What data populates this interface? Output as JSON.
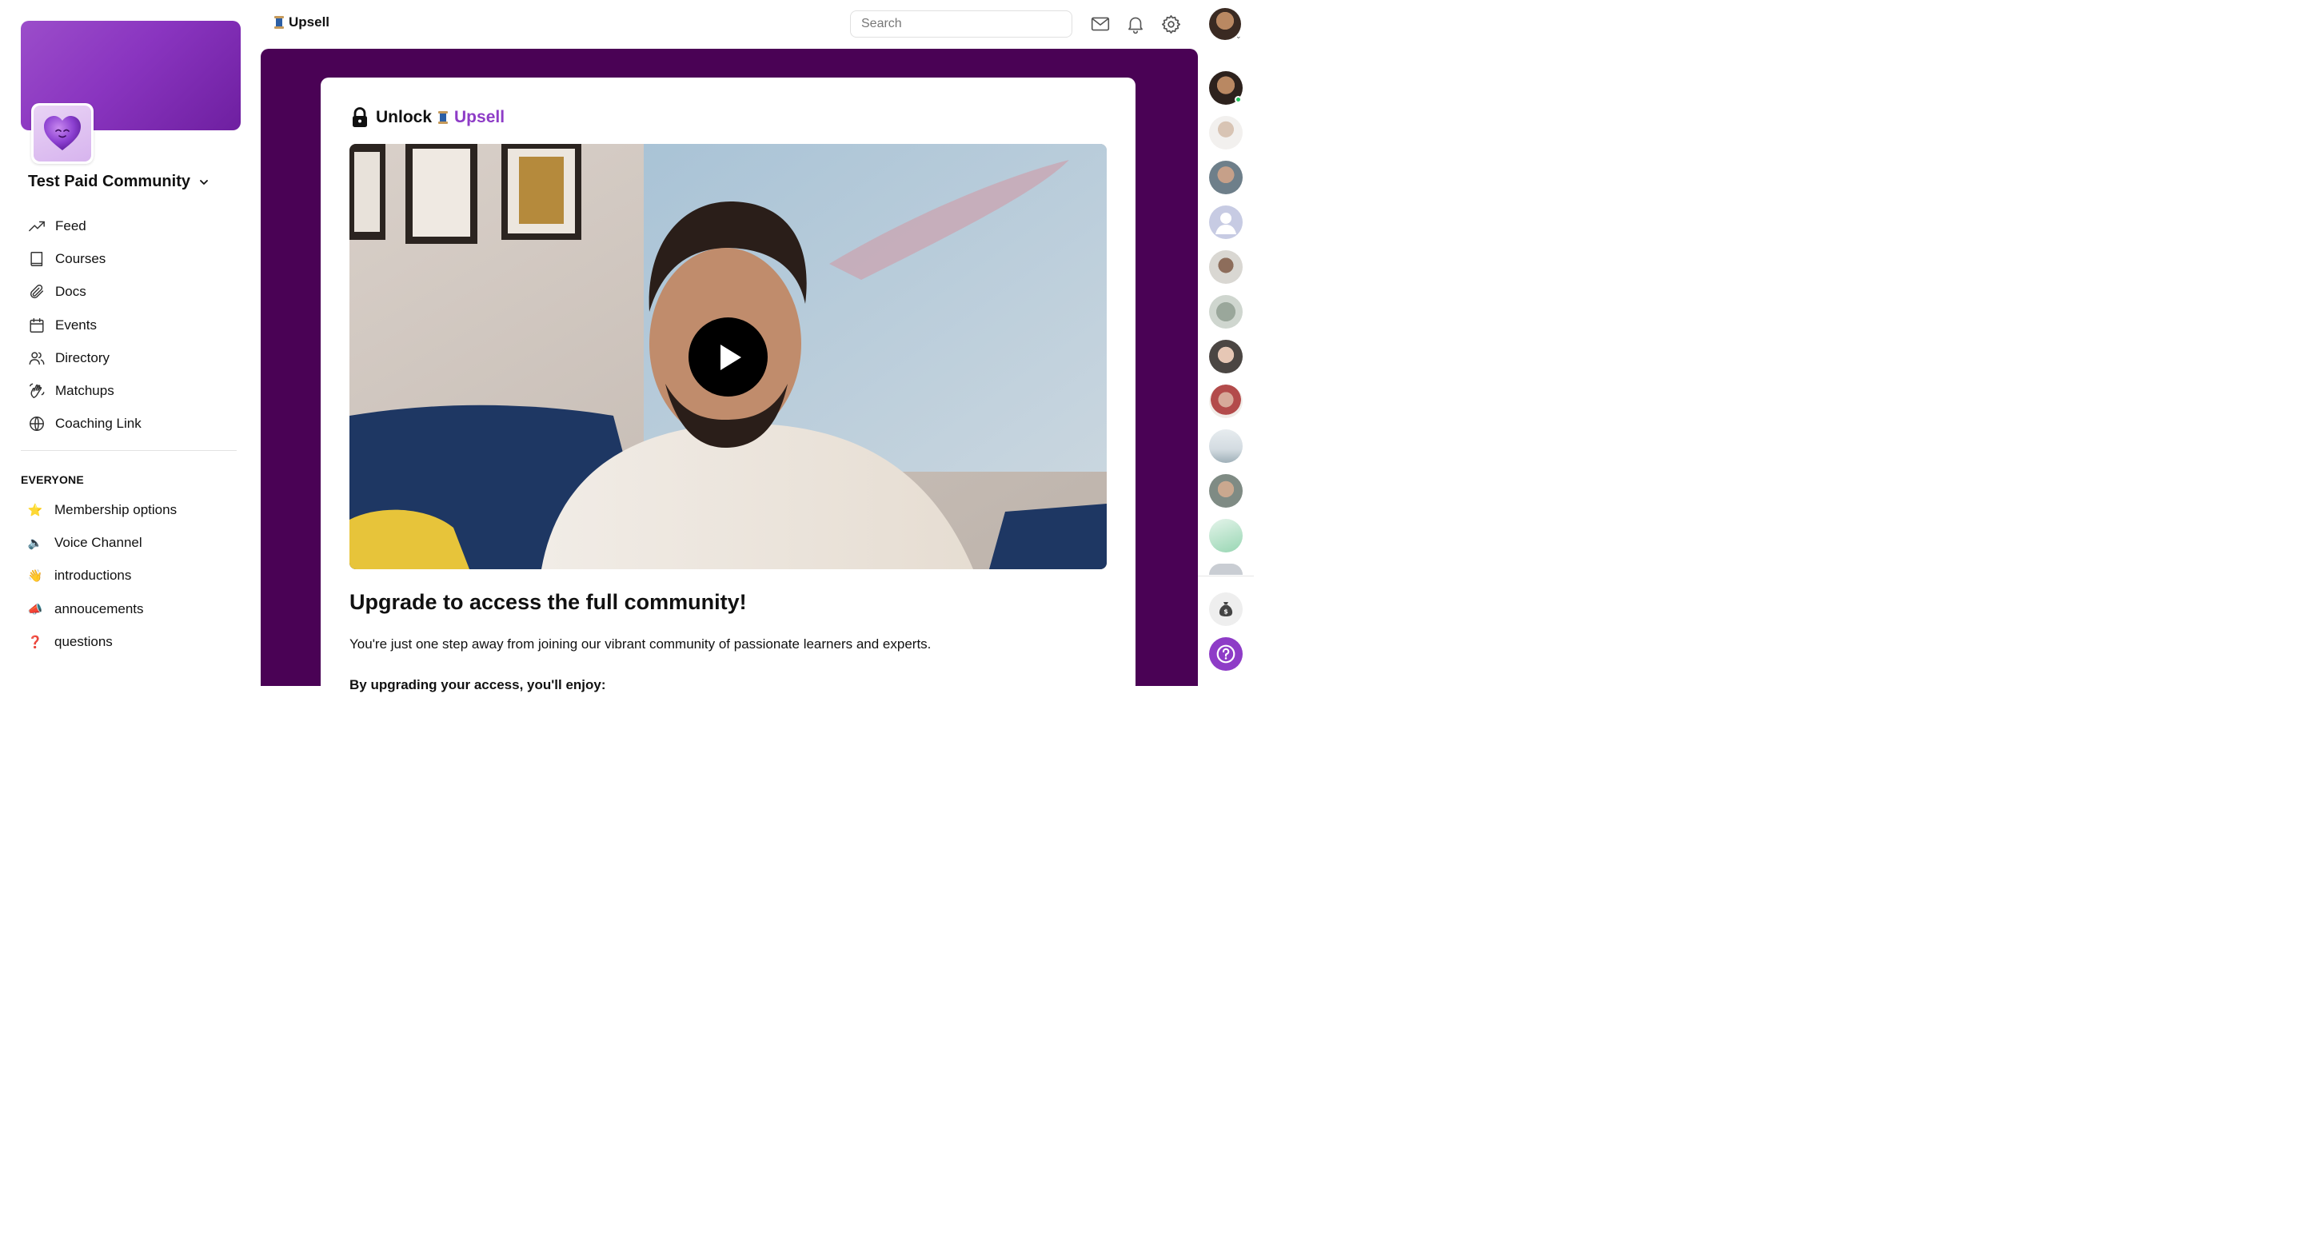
{
  "sidebar": {
    "community_name": "Test Paid Community",
    "nav": [
      {
        "label": "Feed",
        "icon": "trending-up-icon"
      },
      {
        "label": "Courses",
        "icon": "book-icon"
      },
      {
        "label": "Docs",
        "icon": "paperclip-icon"
      },
      {
        "label": "Events",
        "icon": "calendar-icon"
      },
      {
        "label": "Directory",
        "icon": "users-icon"
      },
      {
        "label": "Matchups",
        "icon": "waving-hand-icon"
      },
      {
        "label": "Coaching Link",
        "icon": "globe-icon"
      }
    ],
    "section_heading": "EVERYONE",
    "channels": [
      {
        "label": "Membership options",
        "emoji": "⭐"
      },
      {
        "label": "Voice Channel",
        "emoji": "🔈"
      },
      {
        "label": "introductions",
        "emoji": "👋"
      },
      {
        "label": "annoucements",
        "emoji": "📣"
      },
      {
        "label": "questions",
        "emoji": "❓"
      }
    ]
  },
  "topbar": {
    "title": "Upsell",
    "search_placeholder": "Search"
  },
  "card": {
    "unlock_label": "Unlock",
    "unlock_name": "Upsell",
    "headline": "Upgrade to access the full community!",
    "lead": "You're just one step away from joining our vibrant community of passionate learners and experts.",
    "cutoff": "By upgrading your access, you'll enjoy:"
  },
  "colors": {
    "main_bg": "#4a0255",
    "accent": "#8e3cc7",
    "help_button": "#8e3cc7",
    "online": "#22c55e"
  }
}
